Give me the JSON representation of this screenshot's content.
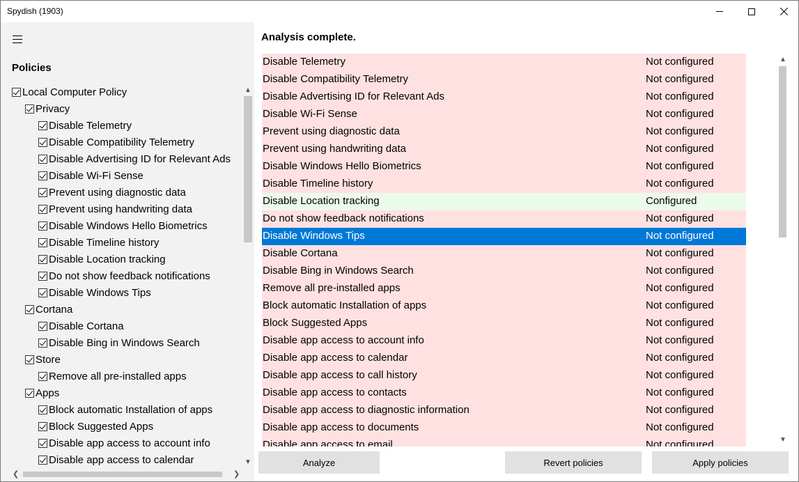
{
  "window": {
    "title": "Spydish (1903)"
  },
  "sidebar": {
    "heading": "Policies",
    "tree": [
      {
        "label": "Local Computer Policy",
        "level": 0,
        "checked": true
      },
      {
        "label": "Privacy",
        "level": 1,
        "checked": true
      },
      {
        "label": "Disable Telemetry",
        "level": 2,
        "checked": true
      },
      {
        "label": "Disable Compatibility Telemetry",
        "level": 2,
        "checked": true
      },
      {
        "label": "Disable Advertising ID for Relevant Ads",
        "level": 2,
        "checked": true
      },
      {
        "label": "Disable Wi-Fi Sense",
        "level": 2,
        "checked": true
      },
      {
        "label": "Prevent using diagnostic data",
        "level": 2,
        "checked": true
      },
      {
        "label": "Prevent using handwriting data",
        "level": 2,
        "checked": true
      },
      {
        "label": "Disable Windows Hello Biometrics",
        "level": 2,
        "checked": true
      },
      {
        "label": "Disable Timeline history",
        "level": 2,
        "checked": true
      },
      {
        "label": "Disable Location tracking",
        "level": 2,
        "checked": true
      },
      {
        "label": "Do not show feedback notifications",
        "level": 2,
        "checked": true
      },
      {
        "label": "Disable Windows Tips",
        "level": 2,
        "checked": true
      },
      {
        "label": "Cortana",
        "level": 1,
        "checked": true
      },
      {
        "label": "Disable Cortana",
        "level": 2,
        "checked": true
      },
      {
        "label": "Disable Bing in Windows Search",
        "level": 2,
        "checked": true
      },
      {
        "label": "Store",
        "level": 1,
        "checked": true
      },
      {
        "label": "Remove all pre-installed apps",
        "level": 2,
        "checked": true
      },
      {
        "label": "Apps",
        "level": 1,
        "checked": true
      },
      {
        "label": "Block automatic Installation of apps",
        "level": 2,
        "checked": true
      },
      {
        "label": "Block Suggested Apps",
        "level": 2,
        "checked": true
      },
      {
        "label": "Disable app access to account info",
        "level": 2,
        "checked": true
      },
      {
        "label": "Disable app access to calendar",
        "level": 2,
        "checked": true
      }
    ]
  },
  "main": {
    "status": "Analysis complete.",
    "rows": [
      {
        "name": "Disable Telemetry",
        "value": "Not configured",
        "state": "not"
      },
      {
        "name": "Disable Compatibility Telemetry",
        "value": "Not configured",
        "state": "not"
      },
      {
        "name": "Disable Advertising ID for Relevant Ads",
        "value": "Not configured",
        "state": "not"
      },
      {
        "name": "Disable Wi-Fi Sense",
        "value": "Not configured",
        "state": "not"
      },
      {
        "name": "Prevent using diagnostic data",
        "value": "Not configured",
        "state": "not"
      },
      {
        "name": "Prevent using handwriting data",
        "value": "Not configured",
        "state": "not"
      },
      {
        "name": "Disable Windows Hello Biometrics",
        "value": "Not configured",
        "state": "not"
      },
      {
        "name": "Disable Timeline history",
        "value": "Not configured",
        "state": "not"
      },
      {
        "name": "Disable Location tracking",
        "value": "Configured",
        "state": "ok"
      },
      {
        "name": "Do not show feedback notifications",
        "value": "Not configured",
        "state": "not"
      },
      {
        "name": "Disable Windows Tips",
        "value": "Not configured",
        "state": "selected"
      },
      {
        "name": "Disable Cortana",
        "value": "Not configured",
        "state": "not"
      },
      {
        "name": "Disable Bing in Windows Search",
        "value": "Not configured",
        "state": "not"
      },
      {
        "name": "Remove all pre-installed apps",
        "value": "Not configured",
        "state": "not"
      },
      {
        "name": "Block automatic Installation of apps",
        "value": "Not configured",
        "state": "not"
      },
      {
        "name": "Block Suggested Apps",
        "value": "Not configured",
        "state": "not"
      },
      {
        "name": "Disable app access to account info",
        "value": "Not configured",
        "state": "not"
      },
      {
        "name": "Disable app access to calendar",
        "value": "Not configured",
        "state": "not"
      },
      {
        "name": "Disable app access to call history",
        "value": "Not configured",
        "state": "not"
      },
      {
        "name": "Disable app access to contacts",
        "value": "Not configured",
        "state": "not"
      },
      {
        "name": "Disable app access to diagnostic information",
        "value": "Not configured",
        "state": "not"
      },
      {
        "name": "Disable app access to documents",
        "value": "Not configured",
        "state": "not"
      },
      {
        "name": "Disable app access to email",
        "value": "Not configured",
        "state": "not"
      }
    ]
  },
  "buttons": {
    "analyze": "Analyze",
    "revert": "Revert policies",
    "apply": "Apply policies"
  },
  "colors": {
    "not_configured_row": "#ffe1e1",
    "configured_row": "#ecfaec",
    "selected_row": "#0078d7",
    "sidebar_bg": "#f2f2f2",
    "button_bg": "#e1e1e1"
  },
  "icons": {
    "menu": "hamburger-icon",
    "minimize": "minimize-icon",
    "maximize": "maximize-icon",
    "close": "close-icon",
    "checkbox": "checkbox-checked-icon"
  }
}
